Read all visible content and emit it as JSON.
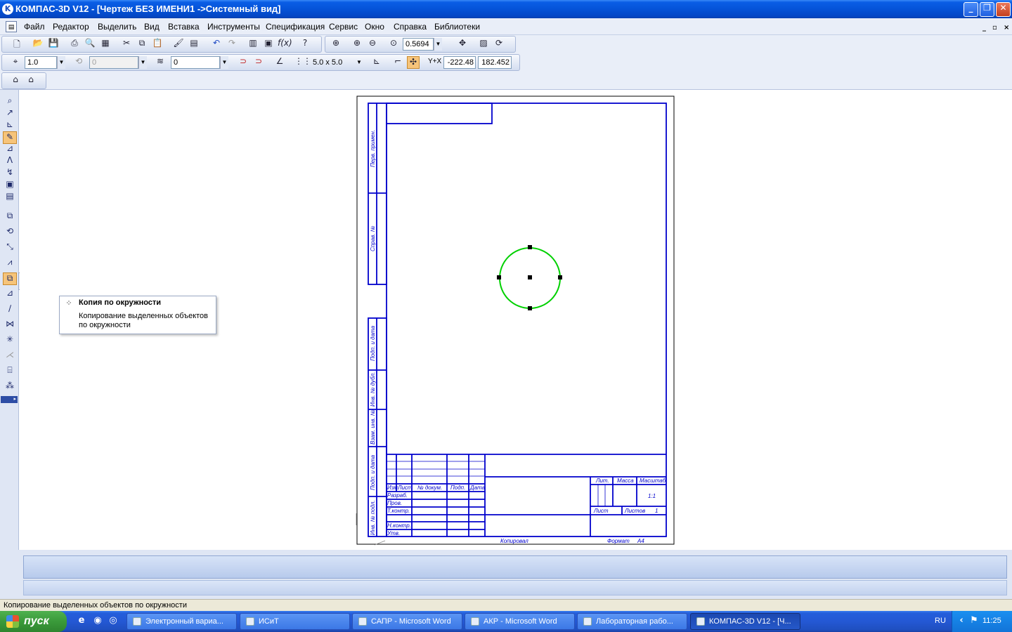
{
  "window": {
    "title": "КОМПАС-3D V12 - [Чертеж БЕЗ ИМЕНИ1 ->Системный вид]",
    "app_icon": "kompas-logo-icon",
    "controls": [
      "minimize-icon",
      "restore-icon",
      "close-icon"
    ]
  },
  "menu": {
    "items": [
      "Файл",
      "Редактор",
      "Выделить",
      "Вид",
      "Вставка",
      "Инструменты",
      "Спецификация",
      "Сервис",
      "Окно",
      "Справка",
      "Библиотеки"
    ],
    "mdi_controls": [
      "_",
      "▫",
      "×"
    ]
  },
  "toolbar_standard": {
    "zoom_value": "0.5694"
  },
  "toolbar_current_state": {
    "scale_value": "1.0",
    "style_value": "0",
    "layer_value": "0",
    "grid_value": "5.0 x 5.0",
    "coord_label": "Y+X",
    "coord_x": "-222.48",
    "coord_y": "182.452"
  },
  "tooltip": {
    "title": "Копия по окружности",
    "description": "Копирование выделенных объектов по окружности"
  },
  "drawing": {
    "side_labels": [
      "Перв. примен.",
      "Справ. №",
      "Подп. и дата",
      "Инв. № дубл.",
      "Взам. инв. №",
      "Подп. и дата",
      "Инв. № подл."
    ],
    "title_block": {
      "lit": "Лит.",
      "massa": "Масса",
      "masshtab": "Масштаб",
      "scale_value": "1:1",
      "list": "Лист",
      "listov": "Листов",
      "listov_value": "1",
      "rows": [
        "Изм.",
        "Лист",
        "№ докум.",
        "Подп.",
        "Дата"
      ],
      "roles": [
        "Разраб.",
        "Пров.",
        "Т.контр.",
        "Н.контр.",
        "Утв."
      ],
      "kopiroval": "Копировал",
      "format": "Формат",
      "format_value": "А4"
    },
    "circle_color": "#00d000",
    "frame_color": "#0000cc"
  },
  "status": {
    "text": "Копирование выделенных объектов по окружности"
  },
  "taskbar": {
    "start_label": "пуск",
    "tasks": [
      {
        "label": "Электронный вариа...",
        "active": false
      },
      {
        "label": "ИСиТ",
        "active": false
      },
      {
        "label": "САПР - Microsoft Word",
        "active": false
      },
      {
        "label": "АКР - Microsoft Word",
        "active": false
      },
      {
        "label": "Лабораторная рабо...",
        "active": false
      },
      {
        "label": "КОМПАС-3D V12 - [Ч...",
        "active": true
      }
    ],
    "lang": "RU",
    "clock": "11:25"
  }
}
